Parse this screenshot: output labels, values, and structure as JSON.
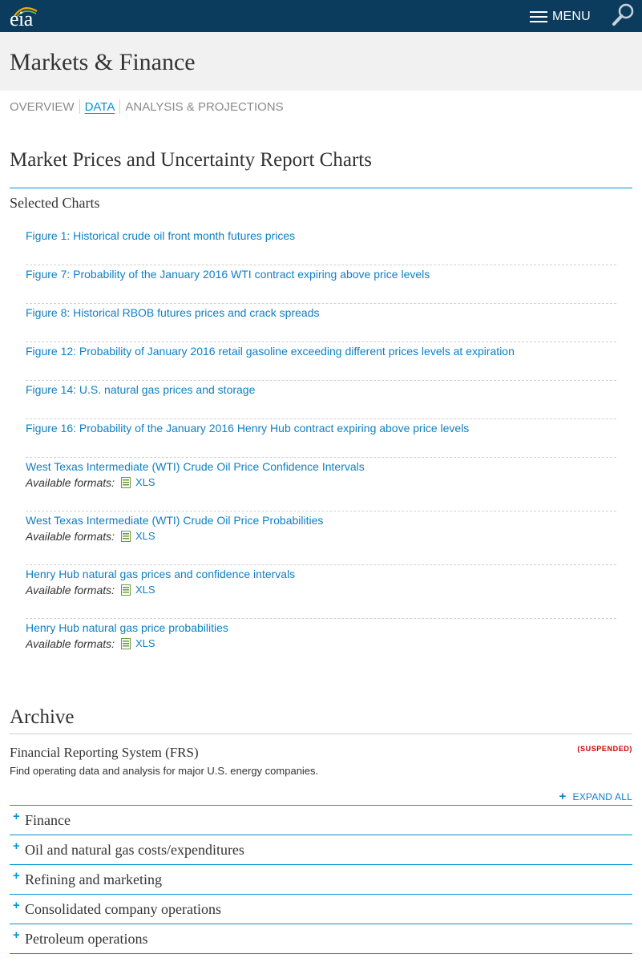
{
  "header": {
    "logo_text": "eia",
    "menu_label": "MENU",
    "icons": {
      "menu": "hamburger-icon",
      "search": "search-icon",
      "logo": "eia-logo"
    },
    "colors": {
      "bar": "#0b3c5d",
      "accent": "#0096d7",
      "link": "#0f7fc4"
    }
  },
  "page": {
    "title": "Markets & Finance"
  },
  "subnav": [
    {
      "label": "OVERVIEW",
      "active": false
    },
    {
      "label": "DATA",
      "active": true
    },
    {
      "label": "ANALYSIS & PROJECTIONS",
      "active": false
    }
  ],
  "main": {
    "title": "Market Prices and Uncertainty Report Charts",
    "selected_heading": "Selected Charts",
    "formats_label": "Available formats:",
    "charts": [
      {
        "label": "Figure 1: Historical crude oil front month futures prices"
      },
      {
        "label": "Figure 7: Probability of the January 2016 WTI contract expiring above price levels"
      },
      {
        "label": "Figure 8: Historical RBOB futures prices and crack spreads"
      },
      {
        "label": "Figure 12: Probability of January 2016 retail gasoline exceeding different prices levels at expiration"
      },
      {
        "label": "Figure 14: U.S. natural gas prices and storage"
      },
      {
        "label": "Figure 16: Probability of the January 2016 Henry Hub contract expiring above price levels"
      },
      {
        "label": "West Texas Intermediate (WTI) Crude Oil Price Confidence Intervals",
        "format": "XLS"
      },
      {
        "label": "West Texas Intermediate (WTI) Crude Oil Price Probabilities",
        "format": "XLS"
      },
      {
        "label": "Henry Hub natural gas prices and confidence intervals",
        "format": "XLS"
      },
      {
        "label": "Henry Hub natural gas price probabilities",
        "format": "XLS"
      }
    ]
  },
  "archive": {
    "title": "Archive",
    "frs_title": "Financial Reporting System (FRS)",
    "frs_badge": "(SUSPENDED)",
    "frs_desc": "Find operating data and analysis for major U.S. energy companies.",
    "expand_all": "EXPAND ALL",
    "sections": [
      "Finance",
      "Oil and natural gas costs/expenditures",
      "Refining and marketing",
      "Consolidated company operations",
      "Petroleum operations"
    ]
  }
}
